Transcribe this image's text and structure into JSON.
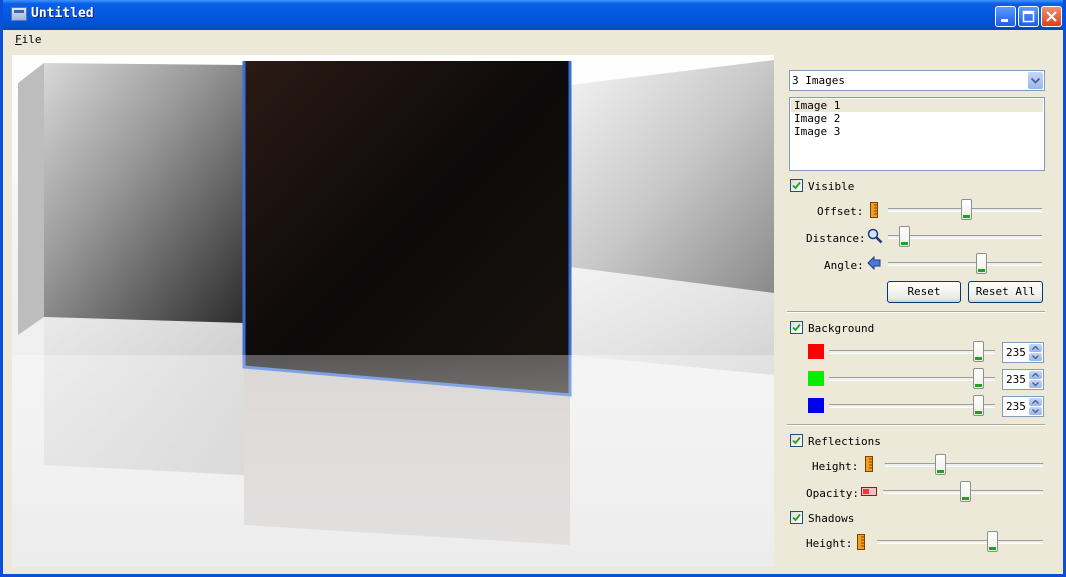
{
  "window": {
    "title": "Untitled"
  },
  "menu": {
    "file_u": "F",
    "file_rest": "ile"
  },
  "panel": {
    "image_count_select": "3 Images",
    "images": [
      "Image 1",
      "Image 2",
      "Image 3"
    ],
    "selected_image_index": 0,
    "visible": {
      "label": "Visible",
      "checked": true
    },
    "offset": {
      "label": "Offset:",
      "value": 0.52
    },
    "distance": {
      "label": "Distance:",
      "value": 0.02
    },
    "angle": {
      "label": "Angle:",
      "value": 0.6
    },
    "reset_label": "Reset",
    "reset_all_label": "Reset All",
    "background": {
      "label": "Background",
      "checked": true
    },
    "red": {
      "value": "235",
      "color": "#ff0000",
      "level": 0.92
    },
    "green": {
      "value": "235",
      "color": "#00ee00",
      "level": 0.92
    },
    "blue": {
      "value": "235",
      "color": "#0000ee",
      "level": 0.92
    },
    "reflections": {
      "label": "Reflections",
      "checked": true
    },
    "refl_height": {
      "label": "Height:",
      "value": 0.27
    },
    "refl_opacity": {
      "label": "Opacity:",
      "value": 0.4
    },
    "shadows": {
      "label": "Shadows",
      "checked": true
    },
    "shadow_height": {
      "label": "Height:",
      "value": 0.72
    }
  }
}
